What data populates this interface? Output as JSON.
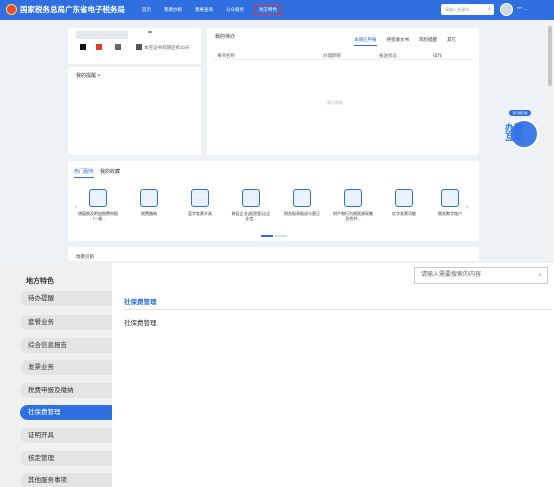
{
  "header": {
    "title": "国家税务总局广东省电子税务局",
    "nav": [
      "首页",
      "我要办税",
      "我要查询",
      "公众服务",
      "地方特色"
    ],
    "active_nav": "地方特色",
    "search_placeholder": "请输入关键词",
    "user_name": "***"
  },
  "user_card": {
    "name": "**",
    "expire_text": "本月证书到期还有10天"
  },
  "remind": {
    "title": "我的提醒 >"
  },
  "todo": {
    "title": "我的待办",
    "tabs": [
      "本期应申报",
      "待签收文书",
      "风险提醒",
      "其它"
    ],
    "columns": [
      "事项名称",
      "办理期限",
      "报送状态",
      "操作"
    ],
    "empty_text": "暂无数据"
  },
  "services": {
    "tabs": [
      "热门服务",
      "我的收藏"
    ],
    "items": [
      "增值税及附加税费申报（一般...",
      "税费缴纳",
      "蓝字发票开具",
      "跨区企业(报验登记)企业信...",
      "财务报表报送与更正",
      "财产和行为税税源采集及合并...",
      "红字发票功能",
      "税务数字账户"
    ]
  },
  "site": {
    "title": "场景引航"
  },
  "assistant": {
    "bubble": "有问题问我",
    "label": "办税互动"
  },
  "overlay": {
    "title": "地方特色",
    "search_placeholder": "请输入需要搜索的内容",
    "menu": [
      "待办提醒",
      "套餐业务",
      "综合信息报告",
      "发票业务",
      "税费申报及缴纳",
      "社保费管理",
      "证明开具",
      "核定管理",
      "其他服务事项"
    ],
    "active_menu": "社保费管理",
    "section_title": "社保费管理",
    "section_items": [
      "社保费管理"
    ]
  }
}
